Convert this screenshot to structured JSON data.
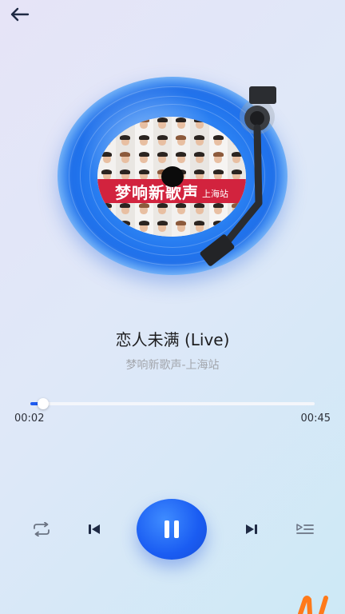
{
  "header": {
    "back_icon": "arrow-left-icon"
  },
  "album": {
    "banner_title": "梦响新歌声",
    "banner_subtitle": "上海站",
    "banner_color": "#d2233e",
    "record_color": "#1e6fea"
  },
  "song": {
    "title": "恋人未满 (Live)",
    "artist": "梦响新歌声-上海站"
  },
  "progress": {
    "current_time": "00:02",
    "total_time": "00:45",
    "fraction": 0.044,
    "accent": "#1e5bf0"
  },
  "controls": {
    "repeat_icon": "repeat-icon",
    "previous_icon": "skip-previous-icon",
    "play_pause_icon": "pause-icon",
    "next_icon": "skip-next-icon",
    "playlist_icon": "playlist-icon",
    "play_button_color": "#1a5cf2"
  },
  "corner_logo_color": "#ff7a1a"
}
